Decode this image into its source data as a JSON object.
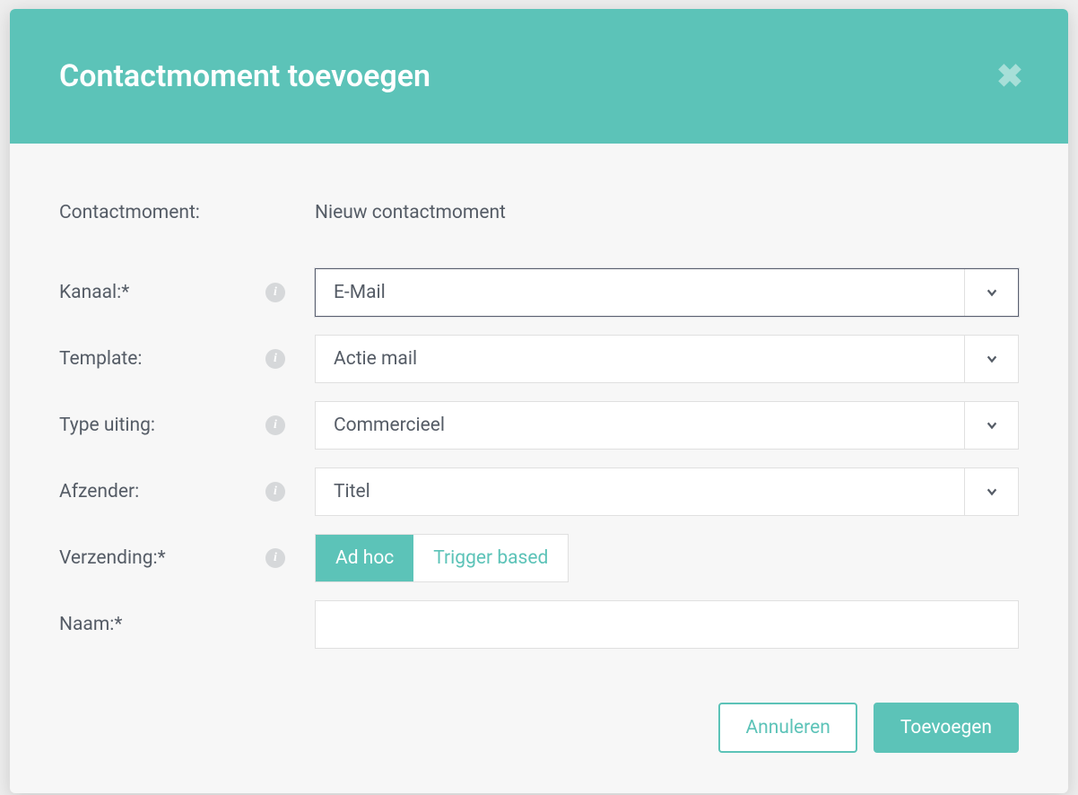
{
  "header": {
    "title": "Contactmoment toevoegen"
  },
  "form": {
    "contactmoment": {
      "label": "Contactmoment:",
      "value": "Nieuw contactmoment"
    },
    "kanaal": {
      "label": "Kanaal:*",
      "value": "E-Mail"
    },
    "template": {
      "label": "Template:",
      "value": "Actie mail"
    },
    "type_uiting": {
      "label": "Type uiting:",
      "value": "Commercieel"
    },
    "afzender": {
      "label": "Afzender:",
      "value": "Titel"
    },
    "verzending": {
      "label": "Verzending:*",
      "options": {
        "adhoc": "Ad hoc",
        "trigger": "Trigger based"
      },
      "selected": "adhoc"
    },
    "naam": {
      "label": "Naam:*",
      "value": ""
    }
  },
  "footer": {
    "cancel": "Annuleren",
    "submit": "Toevoegen"
  }
}
